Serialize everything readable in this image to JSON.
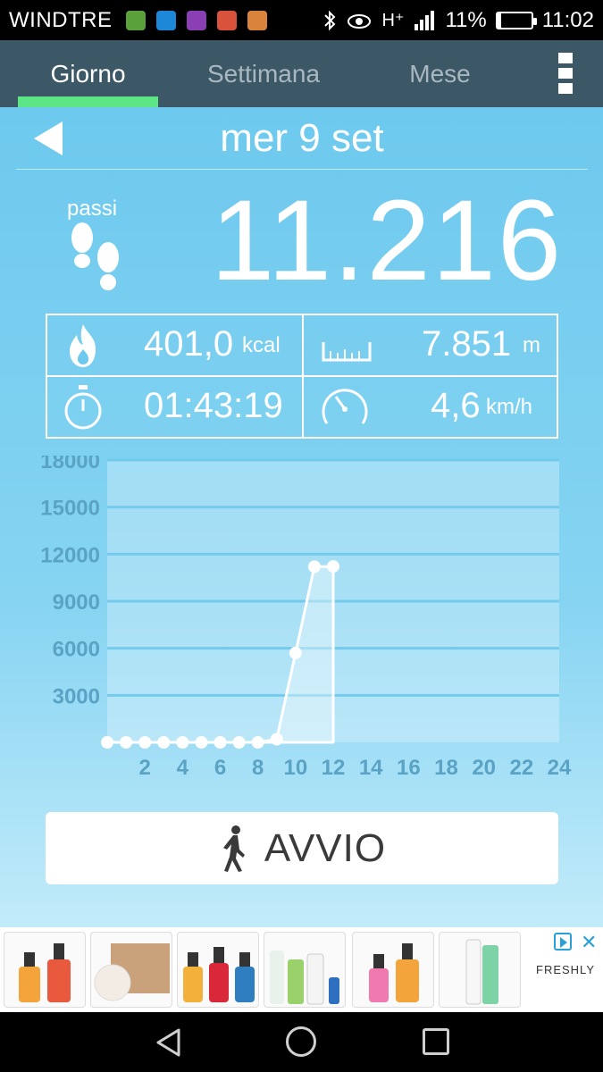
{
  "status_bar": {
    "carrier": "WINDTRE",
    "network": "H⁺",
    "battery": "11%",
    "battery_level": 0.11,
    "time": "11:02",
    "icons": [
      "eye-icon",
      "bluetooth-icon",
      "signal-icon"
    ]
  },
  "tabs": [
    {
      "label": "Giorno",
      "active": true
    },
    {
      "label": "Settimana",
      "active": false
    },
    {
      "label": "Mese",
      "active": false
    }
  ],
  "date": "mer 9 set",
  "steps": {
    "label": "passi",
    "value": "11.216"
  },
  "metrics": {
    "calories": {
      "value": "401,0",
      "unit": "kcal",
      "icon": "flame-icon"
    },
    "distance": {
      "value": "7.851",
      "unit": "m",
      "icon": "ruler-icon"
    },
    "duration": {
      "value": "01:43:19",
      "icon": "stopwatch-icon"
    },
    "speed": {
      "value": "4,6",
      "unit": "km/h",
      "icon": "speedometer-icon"
    }
  },
  "chart_data": {
    "type": "area",
    "title": "",
    "xlabel": "",
    "ylabel": "",
    "ylim": [
      0,
      18000
    ],
    "yticks": [
      3000,
      6000,
      9000,
      12000,
      15000,
      18000
    ],
    "ytick_labels": [
      "3000",
      "6000",
      "9000",
      "12000",
      "15000",
      "18000"
    ],
    "xlim": [
      0,
      24
    ],
    "xticks": [
      2,
      4,
      6,
      8,
      10,
      12,
      14,
      16,
      18,
      20,
      22,
      24
    ],
    "xtick_labels": [
      "2",
      "4",
      "6",
      "8",
      "10",
      "12",
      "14",
      "16",
      "18",
      "20",
      "22",
      "24"
    ],
    "grid": true,
    "points": [
      {
        "x": 0,
        "y": 0
      },
      {
        "x": 1,
        "y": 0
      },
      {
        "x": 2,
        "y": 0
      },
      {
        "x": 3,
        "y": 0
      },
      {
        "x": 4,
        "y": 0
      },
      {
        "x": 5,
        "y": 0
      },
      {
        "x": 6,
        "y": 0
      },
      {
        "x": 7,
        "y": 0
      },
      {
        "x": 8,
        "y": 0
      },
      {
        "x": 9,
        "y": 200
      },
      {
        "x": 10,
        "y": 5700
      },
      {
        "x": 11,
        "y": 11200
      },
      {
        "x": 12,
        "y": 11216
      }
    ]
  },
  "start_button": {
    "label": "AVVIO",
    "icon": "walker-icon"
  },
  "ad": {
    "brand": "FRESHLY",
    "tiles": [
      "serum-pair",
      "cotton-pads",
      "serum-trio",
      "spray-set",
      "serum-pink",
      "tube-cream"
    ]
  },
  "nav": {
    "back": "back-icon",
    "home": "home-icon",
    "recent": "recent-apps-icon"
  },
  "colors": {
    "tab_bar": "#3c5766",
    "tab_indicator": "#5be585",
    "main_bg": "#6dc9ee",
    "axis_text": "#5aa3c4"
  }
}
